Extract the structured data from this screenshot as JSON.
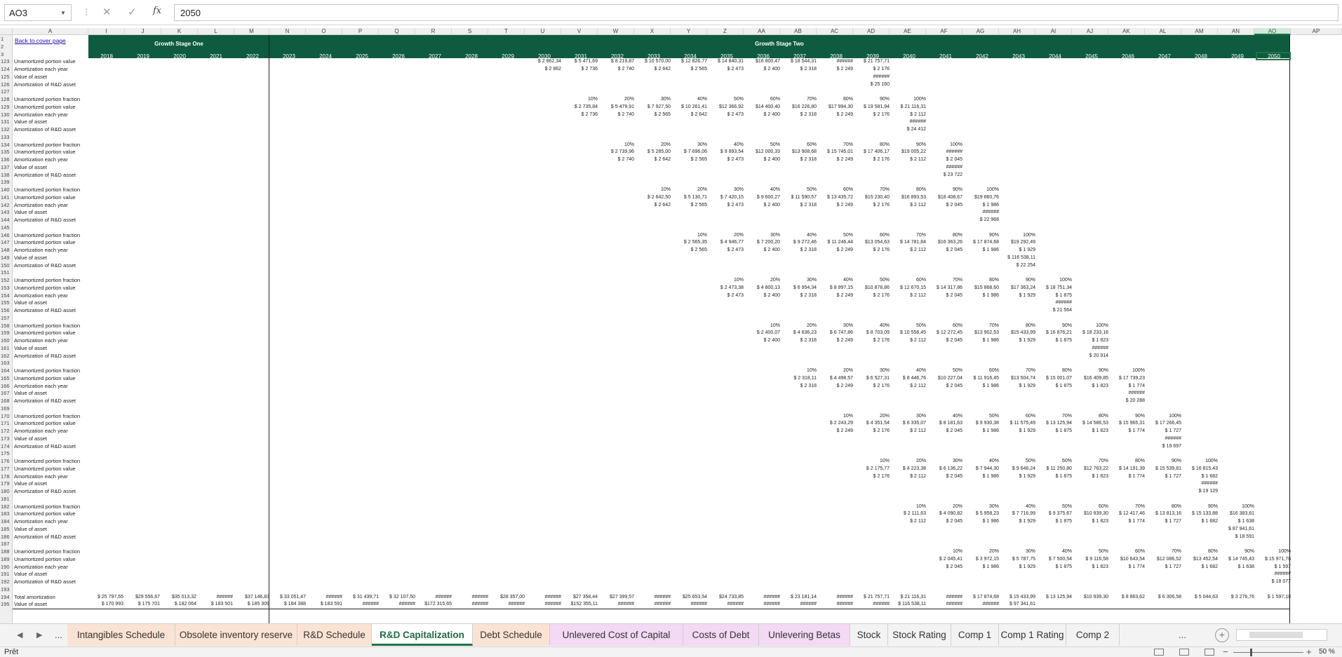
{
  "formula_bar": {
    "name_box": "AO3",
    "fx_label": "fx",
    "formula": "2050"
  },
  "sheet": {
    "back_link": "Back to cover page",
    "stage_one": "Growth Stage One",
    "stage_two": "Growth Stage Two",
    "columns": [
      "A",
      "I",
      "J",
      "K",
      "L",
      "M",
      "N",
      "O",
      "P",
      "Q",
      "R",
      "S",
      "T",
      "U",
      "V",
      "W",
      "X",
      "Y",
      "Z",
      "AA",
      "AB",
      "AC",
      "AD",
      "AE",
      "AF",
      "AG",
      "AH",
      "AI",
      "AJ",
      "AK",
      "AL",
      "AM",
      "AN",
      "AO",
      "AP"
    ],
    "years": [
      "2018",
      "2019",
      "2020",
      "2021",
      "2022",
      "2023",
      "2024",
      "2025",
      "2026",
      "2027",
      "2028",
      "2029",
      "2030",
      "2031",
      "2032",
      "2033",
      "2034",
      "2035",
      "2036",
      "2037",
      "2038",
      "2039",
      "2040",
      "2041",
      "2042",
      "2043",
      "2044",
      "2045",
      "2046",
      "2047",
      "2048",
      "2049",
      "2050"
    ],
    "rows": [
      {
        "n": "1",
        "label": ""
      },
      {
        "n": "2",
        "label": ""
      },
      {
        "n": "3",
        "label": ""
      },
      {
        "n": "123",
        "label": "Unamortized portion value"
      },
      {
        "n": "124",
        "label": "Amortization each year"
      },
      {
        "n": "125",
        "label": "Value of asset"
      },
      {
        "n": "126",
        "label": "Amortization of R&D asset"
      },
      {
        "n": "127",
        "label": ""
      },
      {
        "n": "128",
        "label": "Unamortized portion fraction"
      },
      {
        "n": "129",
        "label": "Unamortized portion value"
      },
      {
        "n": "130",
        "label": "Amortization each year"
      },
      {
        "n": "131",
        "label": "Value of asset"
      },
      {
        "n": "132",
        "label": "Amortization of R&D asset"
      },
      {
        "n": "133",
        "label": ""
      },
      {
        "n": "134",
        "label": "Unamortized portion fraction"
      },
      {
        "n": "135",
        "label": "Unamortized portion value"
      },
      {
        "n": "136",
        "label": "Amortization each year"
      },
      {
        "n": "137",
        "label": "Value of asset"
      },
      {
        "n": "138",
        "label": "Amortization of R&D asset"
      },
      {
        "n": "139",
        "label": ""
      },
      {
        "n": "140",
        "label": "Unamortized portion fraction"
      },
      {
        "n": "141",
        "label": "Unamortized portion value"
      },
      {
        "n": "142",
        "label": "Amortization each year"
      },
      {
        "n": "143",
        "label": "Value of asset"
      },
      {
        "n": "144",
        "label": "Amortization of R&D asset"
      },
      {
        "n": "145",
        "label": ""
      },
      {
        "n": "146",
        "label": "Unamortized portion fraction"
      },
      {
        "n": "147",
        "label": "Unamortized portion value"
      },
      {
        "n": "148",
        "label": "Amortization each year"
      },
      {
        "n": "149",
        "label": "Value of asset"
      },
      {
        "n": "150",
        "label": "Amortization of R&D asset"
      },
      {
        "n": "151",
        "label": ""
      },
      {
        "n": "152",
        "label": "Unamortized portion fraction"
      },
      {
        "n": "153",
        "label": "Unamortized portion value"
      },
      {
        "n": "154",
        "label": "Amortization each year"
      },
      {
        "n": "155",
        "label": "Value of asset"
      },
      {
        "n": "156",
        "label": "Amortization of R&D asset"
      },
      {
        "n": "157",
        "label": ""
      },
      {
        "n": "158",
        "label": "Unamortized portion fraction"
      },
      {
        "n": "159",
        "label": "Unamortized portion value"
      },
      {
        "n": "160",
        "label": "Amortization each year"
      },
      {
        "n": "161",
        "label": "Value of asset"
      },
      {
        "n": "162",
        "label": "Amortization of R&D asset"
      },
      {
        "n": "163",
        "label": ""
      },
      {
        "n": "164",
        "label": "Unamortized portion fraction"
      },
      {
        "n": "165",
        "label": "Unamortized portion value"
      },
      {
        "n": "166",
        "label": "Amortization each year"
      },
      {
        "n": "167",
        "label": "Value of asset"
      },
      {
        "n": "168",
        "label": "Amortization of R&D asset"
      },
      {
        "n": "169",
        "label": ""
      },
      {
        "n": "170",
        "label": "Unamortized portion fraction"
      },
      {
        "n": "171",
        "label": "Unamortized portion value"
      },
      {
        "n": "172",
        "label": "Amortization each year"
      },
      {
        "n": "173",
        "label": "Value of asset"
      },
      {
        "n": "174",
        "label": "Amortization of R&D asset"
      },
      {
        "n": "175",
        "label": ""
      },
      {
        "n": "176",
        "label": "Unamortized portion fraction"
      },
      {
        "n": "177",
        "label": "Unamortized portion value"
      },
      {
        "n": "178",
        "label": "Amortization each year"
      },
      {
        "n": "179",
        "label": "Value of asset"
      },
      {
        "n": "180",
        "label": "Amortization of R&D asset"
      },
      {
        "n": "181",
        "label": ""
      },
      {
        "n": "182",
        "label": "Unamortized portion fraction"
      },
      {
        "n": "183",
        "label": "Unamortized portion value"
      },
      {
        "n": "184",
        "label": "Amortization each year"
      },
      {
        "n": "185",
        "label": "Value of asset"
      },
      {
        "n": "186",
        "label": "Amortization of R&D asset"
      },
      {
        "n": "187",
        "label": ""
      },
      {
        "n": "188",
        "label": "Unamortized portion fraction"
      },
      {
        "n": "189",
        "label": "Unamortized portion value"
      },
      {
        "n": "190",
        "label": "Amortization each year"
      },
      {
        "n": "191",
        "label": "Value of asset"
      },
      {
        "n": "192",
        "label": "Amortization of R&D asset"
      },
      {
        "n": "193",
        "label": ""
      },
      {
        "n": "194",
        "label": "Total amortization"
      },
      {
        "n": "195",
        "label": "Value of asset"
      }
    ],
    "blocks": [
      {
        "row": 3,
        "start": 12,
        "value": [
          "$ 2 862,34",
          "$ 5 471,69",
          "$ 8 219,87",
          "$ 10 570,00",
          "$ 12 826,77",
          "$ 14 840,31",
          "$16 800,47",
          "$ 18 544,31",
          "######",
          "$ 21 757,71"
        ],
        "amort": [
          "$ 2 862",
          "$ 2 736",
          "$ 2 740",
          "$ 2 642",
          "$ 2 565",
          "$ 2 473",
          "$ 2 400",
          "$ 2 318",
          "$ 2 249",
          "$ 2 176"
        ],
        "asset": "######",
        "rd": "$ 25 160"
      },
      {
        "row": 9,
        "start": 13,
        "fraction": [
          "10%",
          "20%",
          "30%",
          "40%",
          "50%",
          "60%",
          "70%",
          "80%",
          "90%",
          "100%"
        ],
        "value": [
          "$ 2 735,84",
          "$ 5 479,91",
          "$ 7 927,50",
          "$ 10 261,41",
          "$12 366,92",
          "$14 400,40",
          "$16 226,80",
          "$17 994,30",
          "$ 19 581,94",
          "$ 21 116,31"
        ],
        "amort": [
          "$ 2 736",
          "$ 2 740",
          "$ 2 565",
          "$ 2 642",
          "$ 2 473",
          "$ 2 400",
          "$ 2 318",
          "$ 2 249",
          "$ 2 176",
          "$ 2 112"
        ],
        "asset": "######",
        "rd": "$ 24 412"
      },
      {
        "row": 15,
        "start": 14,
        "fraction": [
          "10%",
          "20%",
          "30%",
          "40%",
          "50%",
          "60%",
          "70%",
          "80%",
          "90%",
          "100%"
        ],
        "value": [
          "$ 2 739,96",
          "$ 5 285,00",
          "$ 7 696,06",
          "$ 9 893,54",
          "$12 000,33",
          "$13 908,68",
          "$ 15 745,01",
          "$ 17 406,17",
          "$19 005,22",
          "######"
        ],
        "amort": [
          "$ 2 740",
          "$ 2 642",
          "$ 2 565",
          "$ 2 473",
          "$ 2 400",
          "$ 2 318",
          "$ 2 249",
          "$ 2 176",
          "$ 2 112",
          "$ 2 045"
        ],
        "asset": "######",
        "rd": "$ 23 722"
      },
      {
        "row": 21,
        "start": 15,
        "fraction": [
          "10%",
          "20%",
          "30%",
          "40%",
          "50%",
          "60%",
          "70%",
          "80%",
          "90%",
          "100%"
        ],
        "value": [
          "$ 2 642,50",
          "$ 5 130,71",
          "$ 7 420,15",
          "$ 9 600,27",
          "$ 11 590,57",
          "$ 13 435,72",
          "$15 230,40",
          "$16 893,53",
          "$18 408,67",
          "$19 860,76"
        ],
        "amort": [
          "$ 2 642",
          "$ 2 565",
          "$ 2 473",
          "$ 2 400",
          "$ 2 318",
          "$ 2 249",
          "$ 2 176",
          "$ 2 112",
          "$ 2 045",
          "$ 1 986"
        ],
        "asset": "######",
        "rd": "$ 22 968"
      },
      {
        "row": 27,
        "start": 16,
        "fraction": [
          "10%",
          "20%",
          "30%",
          "40%",
          "50%",
          "60%",
          "70%",
          "80%",
          "90%",
          "100%"
        ],
        "value": [
          "$ 2 565,35",
          "$ 4 946,77",
          "$ 7 200,20",
          "$ 9 272,46",
          "$ 11 246,44",
          "$13 054,63",
          "$ 14 781,84",
          "$16 363,26",
          "$ 17 874,68",
          "$19 292,49"
        ],
        "amort": [
          "$ 2 565",
          "$ 2 473",
          "$ 2 400",
          "$ 2 318",
          "$ 2 249",
          "$ 2 176",
          "$ 2 112",
          "$ 2 045",
          "$ 1 986",
          "$ 1 929"
        ],
        "asset": "$ 116 538,11",
        "rd": "$ 22 254"
      },
      {
        "row": 33,
        "start": 17,
        "fraction": [
          "10%",
          "20%",
          "30%",
          "40%",
          "50%",
          "60%",
          "70%",
          "80%",
          "90%",
          "100%"
        ],
        "value": [
          "$ 2 473,38",
          "$ 4 800,13",
          "$ 6 954,34",
          "$ 8 997,15",
          "$10 878,86",
          "$ 12 670,15",
          "$ 14 317,86",
          "$15 868,60",
          "$17 363,24",
          "$ 18 751,34"
        ],
        "amort": [
          "$ 2 473",
          "$ 2 400",
          "$ 2 318",
          "$ 2 249",
          "$ 2 176",
          "$ 2 112",
          "$ 2 045",
          "$ 1 986",
          "$ 1 929",
          "$ 1 875"
        ],
        "asset": "######",
        "rd": "$ 21 564"
      },
      {
        "row": 39,
        "start": 18,
        "fraction": [
          "10%",
          "20%",
          "30%",
          "40%",
          "50%",
          "60%",
          "70%",
          "80%",
          "90%",
          "100%"
        ],
        "value": [
          "$ 2 400,07",
          "$ 4 636,23",
          "$ 6 747,86",
          "$ 8 703,09",
          "$ 10 558,45",
          "$ 12 272,45",
          "$13 902,53",
          "$15 433,99",
          "$ 16 876,21",
          "$ 18 233,16"
        ],
        "amort": [
          "$ 2 400",
          "$ 2 318",
          "$ 2 249",
          "$ 2 176",
          "$ 2 112",
          "$ 2 045",
          "$ 1 986",
          "$ 1 929",
          "$ 1 875",
          "$ 1 823"
        ],
        "asset": "######",
        "rd": "$ 20 914"
      },
      {
        "row": 45,
        "start": 19,
        "fraction": [
          "10%",
          "20%",
          "30%",
          "40%",
          "50%",
          "60%",
          "70%",
          "80%",
          "90%",
          "100%"
        ],
        "value": [
          "$ 2 318,11",
          "$ 4 498,57",
          "$ 6 527,31",
          "$ 8 446,76",
          "$10 227,04",
          "$ 11 916,45",
          "$13 504,74",
          "$ 15 001,07",
          "$16 409,85",
          "$ 17 739,23"
        ],
        "amort": [
          "$ 2 318",
          "$ 2 249",
          "$ 2 176",
          "$ 2 112",
          "$ 2 045",
          "$ 1 986",
          "$ 1 929",
          "$ 1 875",
          "$ 1 823",
          "$ 1 774"
        ],
        "asset": "######",
        "rd": "$ 20 288"
      },
      {
        "row": 51,
        "start": 20,
        "fraction": [
          "10%",
          "20%",
          "30%",
          "40%",
          "50%",
          "60%",
          "70%",
          "80%",
          "90%",
          "100%"
        ],
        "value": [
          "$ 2 243,29",
          "$ 4 351,54",
          "$ 6 335,07",
          "$ 8 181,63",
          "$ 9 930,38",
          "$ 11 575,49",
          "$ 13 125,94",
          "$ 14 586,53",
          "$ 15 965,31",
          "$ 17 266,45"
        ],
        "amort": [
          "$ 2 249",
          "$ 2 176",
          "$ 2 112",
          "$ 2 045",
          "$ 1 986",
          "$ 1 929",
          "$ 1 875",
          "$ 1 823",
          "$ 1 774",
          "$ 1 727"
        ],
        "asset": "######",
        "rd": "$ 19 697"
      },
      {
        "row": 57,
        "start": 21,
        "fraction": [
          "10%",
          "20%",
          "30%",
          "40%",
          "50%",
          "60%",
          "70%",
          "80%",
          "90%",
          "100%"
        ],
        "value": [
          "$ 2 175,77",
          "$ 4 223,38",
          "$ 6 136,22",
          "$ 7 944,30",
          "$ 9 646,24",
          "$ 11 250,80",
          "$12 763,22",
          "$ 14 191,39",
          "$ 15 539,81",
          "$ 16 815,43"
        ],
        "amort": [
          "$ 2 176",
          "$ 2 112",
          "$ 2 045",
          "$ 1 986",
          "$ 1 929",
          "$ 1 875",
          "$ 1 823",
          "$ 1 774",
          "$ 1 727",
          "$ 1 682"
        ],
        "asset": "######",
        "rd": "$ 19 129"
      },
      {
        "row": 63,
        "start": 22,
        "fraction": [
          "10%",
          "20%",
          "30%",
          "40%",
          "50%",
          "60%",
          "70%",
          "80%",
          "90%",
          "100%"
        ],
        "value": [
          "$ 2 111,63",
          "$ 4 090,82",
          "$ 5 958,23",
          "$ 7 716,99",
          "$ 9 375,67",
          "$10 939,30",
          "$ 12 417,46",
          "$ 13 813,16",
          "$ 15 133,88",
          "$16 383,81"
        ],
        "amort": [
          "$ 2 112",
          "$ 2 045",
          "$ 1 986",
          "$ 1 929",
          "$ 1 875",
          "$ 1 823",
          "$ 1 774",
          "$ 1 727",
          "$ 1 682",
          "$ 1 638"
        ],
        "asset": "$ 87 941,61",
        "rd": "$ 18 591"
      },
      {
        "row": 69,
        "start": 23,
        "fraction": [
          "10%",
          "20%",
          "30%",
          "40%",
          "50%",
          "60%",
          "70%",
          "80%",
          "90%",
          "100%"
        ],
        "value": [
          "$ 2 045,41",
          "$ 3 972,15",
          "$ 5 787,75",
          "$ 7 500,54",
          "$ 9 116,58",
          "$10 643,54",
          "$12 086,52",
          "$13 452,54",
          "$ 14 745,43",
          "$ 15 971,78"
        ],
        "amort": [
          "$ 2 045",
          "$ 1 986",
          "$ 1 929",
          "$ 1 875",
          "$ 1 823",
          "$ 1 774",
          "$ 1 727",
          "$ 1 682",
          "$ 1 638",
          "$ 1 597"
        ],
        "asset": "######",
        "rd": "$ 18 077"
      }
    ],
    "total_amortization": [
      "$ 25 797,55",
      "$29 556,67",
      "$35 013,32",
      "######",
      "$37 146,83",
      "$ 33 051,47",
      "######",
      "$ 31 439,71",
      "$ 32 107,50",
      "######",
      "######",
      "$28 357,00",
      "######",
      "$27 358,44",
      "$27 399,57",
      "######",
      "$25 653,54",
      "$24 733,85",
      "######",
      "$ 23 181,14",
      "######",
      "$ 21 757,71",
      "$ 21 116,31",
      "######",
      "$ 17 874,68",
      "$ 15 433,99",
      "$ 13 125,94",
      "$10 939,30",
      "$ 8 863,62",
      "$ 6 306,58",
      "$ 5 044,63",
      "$ 3 276,76",
      "$ 1 597,18"
    ],
    "value_of_asset": [
      "$ 170 993",
      "$ 175 701",
      "$ 182 064",
      "$ 183 501",
      "$ 185 309",
      "$ 184 388",
      "$ 183 591",
      "######",
      "######",
      "$172 315,65",
      "######",
      "######",
      "######",
      "$152 355,11",
      "######",
      "######",
      "######",
      "######",
      "######",
      "######",
      "######",
      "######",
      "$ 116 538,11",
      "######",
      "######",
      "$ 97 341,61"
    ]
  },
  "tabs": {
    "more_left": "...",
    "items": [
      {
        "label": "Intangibles Schedule",
        "style": "orange"
      },
      {
        "label": "Obsolete inventory reserve",
        "style": "orange"
      },
      {
        "label": "R&D Schedule",
        "style": "orange"
      },
      {
        "label": "R&D Capitalization",
        "style": "active"
      },
      {
        "label": "Debt Schedule",
        "style": "orange"
      },
      {
        "label": "Unlevered Cost of Capital",
        "style": "pink"
      },
      {
        "label": "Costs of Debt",
        "style": "pink"
      },
      {
        "label": "Unlevering Betas",
        "style": "pink"
      },
      {
        "label": "Stock",
        "style": "plain"
      },
      {
        "label": "Stock Rating",
        "style": "plain"
      },
      {
        "label": "Comp 1",
        "style": "plain"
      },
      {
        "label": "Comp 1 Rating",
        "style": "plain"
      },
      {
        "label": "Comp 2",
        "style": "plain"
      }
    ],
    "more_right": "...",
    "add": "+"
  },
  "status": {
    "text": "Prêt",
    "zoom": "50 %"
  }
}
